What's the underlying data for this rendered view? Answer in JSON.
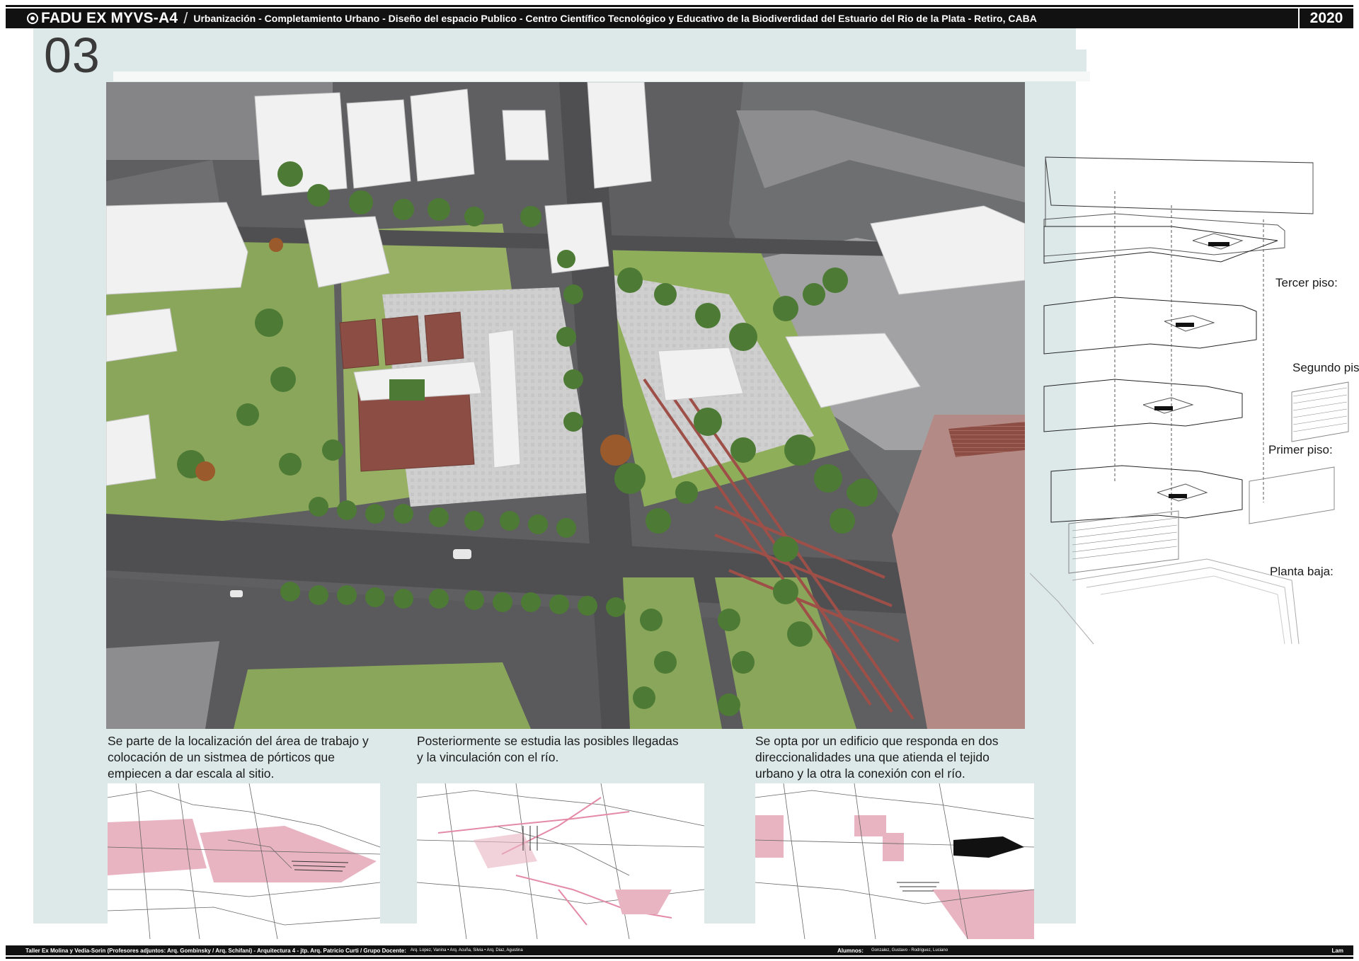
{
  "header": {
    "brand": "FADU EX MYVS-A4",
    "separator": "/",
    "subtitle": "Urbanización - Completamiento Urbano - Diseño del espacio Publico - Centro Científico Tecnológico y Educativo de la Biodiverdidad del Estuario del Rio de la Plata   - Retiro, CABA",
    "year": "2020"
  },
  "page_number": "03",
  "floors": {
    "third": "Tercer piso:",
    "second": "Segundo piso:",
    "first": "Primer piso:",
    "ground": "Planta baja:"
  },
  "captions": [
    {
      "lines": [
        "Se parte de la localización del área de trabajo y",
        "colocación de un sistmea de pórticos que",
        "empiecen a dar escala al sitio."
      ]
    },
    {
      "lines": [
        "Posteriormente se estudia las posibles llegadas",
        "y la vinculación con el río."
      ]
    },
    {
      "lines": [
        "Se opta por un edificio que responda en dos",
        "direccionalidades una que atienda el tejido",
        "urbano y la otra la conexión con el río."
      ]
    }
  ],
  "footer": {
    "left": "Taller Ex Molina y Vedia-Sorin (Profesores adjuntos:  Arq. Gombinsky / Arq. Schifani) - Arquitectura 4 - jtp. Arq. Patricio Curti / Grupo Docente:",
    "left_small": "Arq. Lopez, Vanina • Arq. Acuña, Silvia • Arq. Diaz, Agustina",
    "students_label": "Alumnos:",
    "students": "Gonzalez, Gustavo - Rodriguez, Luciano",
    "sheet": "Lam"
  },
  "colors": {
    "panel_bg": "#dde9e9",
    "header_bg": "#111111",
    "grass": "#8fae5a",
    "tree": "#4d7a34",
    "road": "#5b5b5e",
    "plaza": "#c9c9c9",
    "building": "#f1f1f1",
    "pier": "#b48a86",
    "brick": "#8c4e44",
    "water": "#77787a",
    "diagram_pink": "#e8b4c2"
  }
}
